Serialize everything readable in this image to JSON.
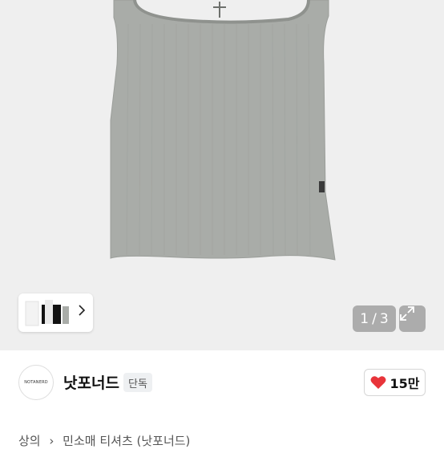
{
  "gallery": {
    "counter_current": "1",
    "counter_separator": "/",
    "counter_total": "3",
    "shirt_color": "#a9aca8"
  },
  "brand": {
    "logo_text": "NOTANERD",
    "name": "낫포너드",
    "badge": "단독",
    "likes": "15만",
    "heart_color": "#e8343a"
  },
  "breadcrumb": {
    "items": [
      "상의",
      "민소매 티셔츠 (낫포너드)"
    ],
    "separator": "›"
  }
}
